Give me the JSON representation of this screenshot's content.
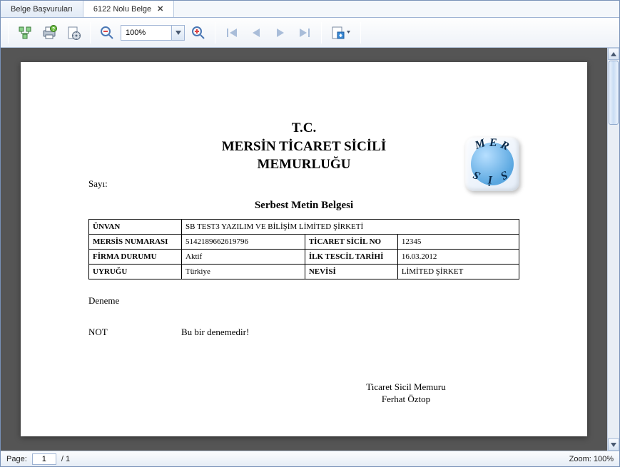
{
  "tabs": {
    "inactive": "Belge Başvuruları",
    "active": "6122 Nolu Belge"
  },
  "toolbar": {
    "zoom_value": "100%"
  },
  "statusbar": {
    "page_label": "Page:",
    "page_current": "1",
    "page_total": "/ 1",
    "zoom_label": "Zoom: 100%"
  },
  "document": {
    "header_line1": "T.C.",
    "header_line2": "MERSİN TİCARET SİCİLİ",
    "header_line3": "MEMURLUĞU",
    "sayi_label": "Sayı:",
    "subtitle": "Serbest Metin Belgesi",
    "rows": {
      "unvan_label": "ÜNVAN",
      "unvan_value": "SB TEST3 YAZILIM VE BİLİŞİM LİMİTED ŞİRKETİ",
      "mersis_label": "MERSİS NUMARASI",
      "mersis_value": "5142189662619796",
      "sicil_label": "TİCARET SİCİL NO",
      "sicil_value": "12345",
      "durum_label": "FİRMA DURUMU",
      "durum_value": "Aktif",
      "tescil_label": "İLK TESCİL TARİHİ",
      "tescil_value": "16.03.2012",
      "uyruk_label": "UYRUĞU",
      "uyruk_value": "Türkiye",
      "nevi_label": "NEVİSİ",
      "nevi_value": "LİMİTED ŞİRKET"
    },
    "body_text": "Deneme",
    "note_key": "NOT",
    "note_value": "Bu bir denemedir!",
    "sig_title": "Ticaret Sicil Memuru",
    "sig_name": "Ferhat Öztop"
  }
}
